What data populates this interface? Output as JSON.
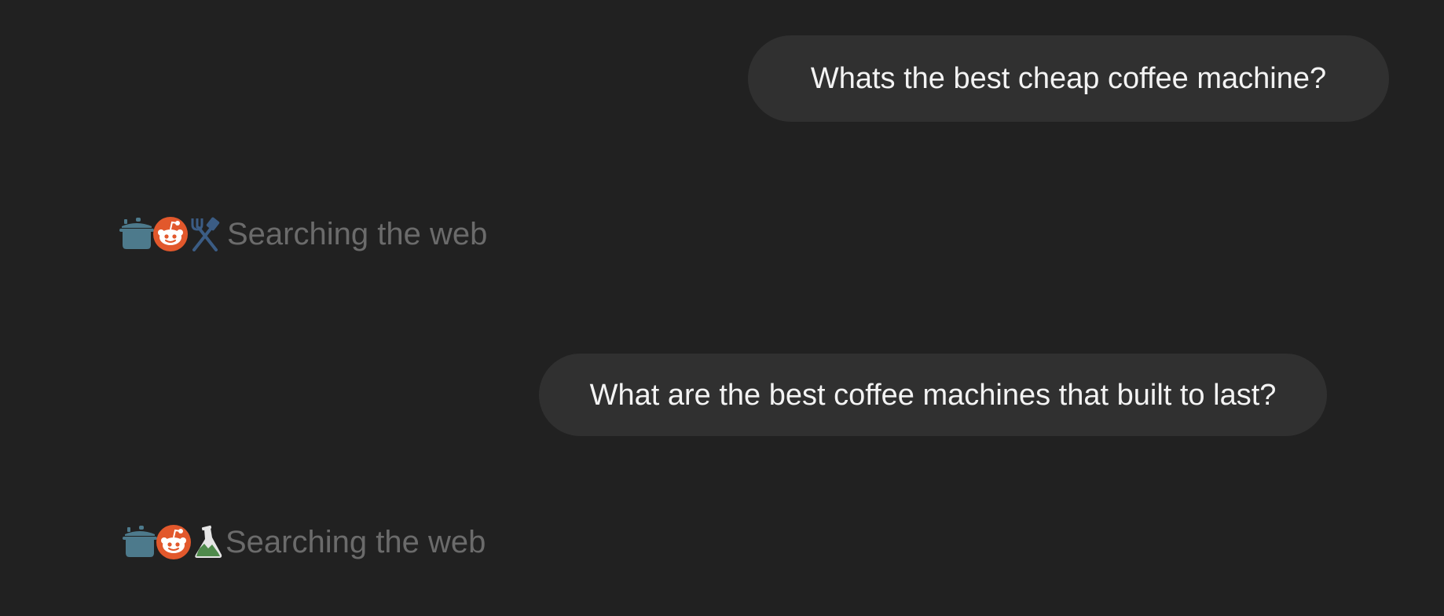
{
  "conversation": {
    "messages": [
      {
        "role": "user",
        "text": "Whats the best cheap coffee machine?"
      },
      {
        "role": "status",
        "text": "Searching the web",
        "icons": [
          "pot-icon",
          "reddit-icon",
          "spatula-fork-icon"
        ]
      },
      {
        "role": "user",
        "text": "What are the best coffee machines that built to last?"
      },
      {
        "role": "status",
        "text": "Searching the web",
        "icons": [
          "pot-icon",
          "reddit-icon",
          "flask-icon"
        ]
      }
    ]
  },
  "colors": {
    "background": "#212121",
    "bubble": "#303030",
    "user_text": "#f3f3f3",
    "status_text": "#6b6b6b",
    "pot": "#4d7a8c",
    "reddit": "#e2582c",
    "utensils": "#3b5c84",
    "flask_liquid": "#4f8a4c"
  }
}
